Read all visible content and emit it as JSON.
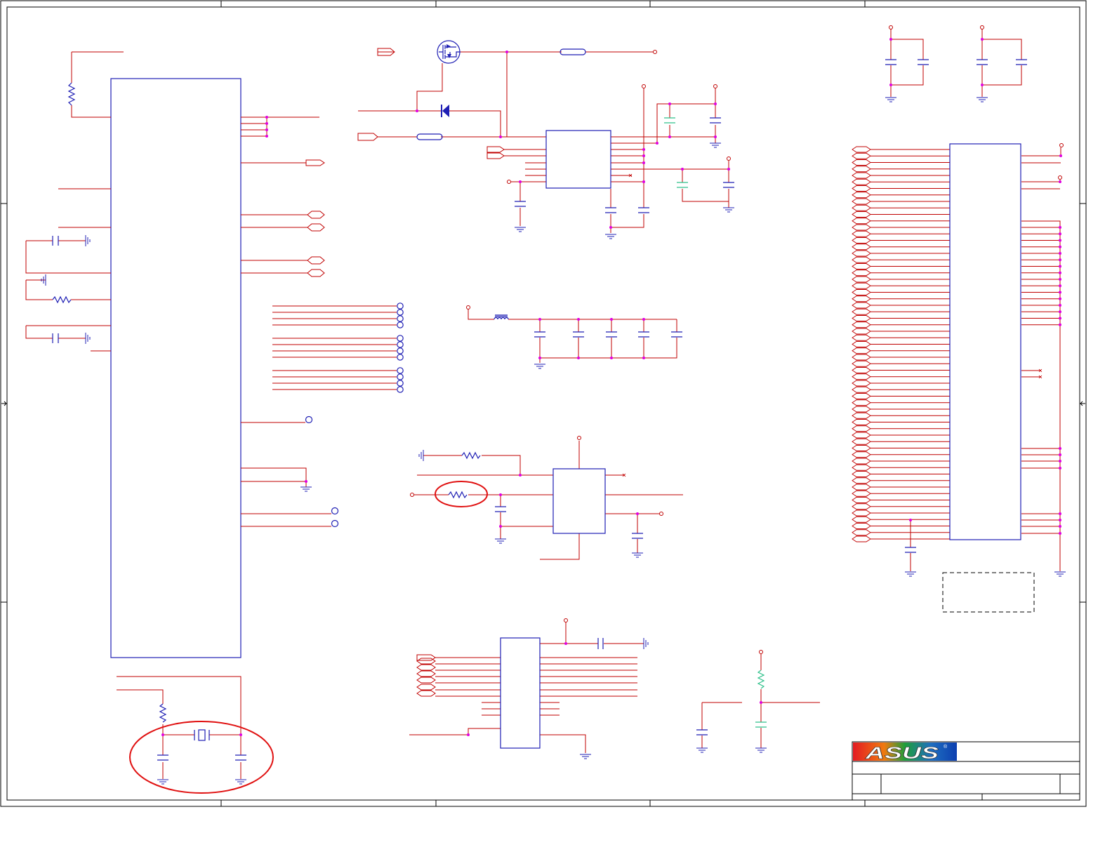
{
  "logo": {
    "text": "ASUS",
    "mark": "®"
  },
  "colors": {
    "wire": "#c00000",
    "component": "#1f1fb4",
    "junction": "#e000e0",
    "highlight": "#e01010",
    "accent_cap": "#2ec08a",
    "frame": "#000000",
    "logo_red": "#e31b23",
    "logo_blue": "#0c3fb0"
  },
  "title_block": {
    "rows": 4
  },
  "highlights": [
    {
      "name": "resistor-highlight"
    },
    {
      "name": "crystal-circuit-highlight"
    }
  ]
}
